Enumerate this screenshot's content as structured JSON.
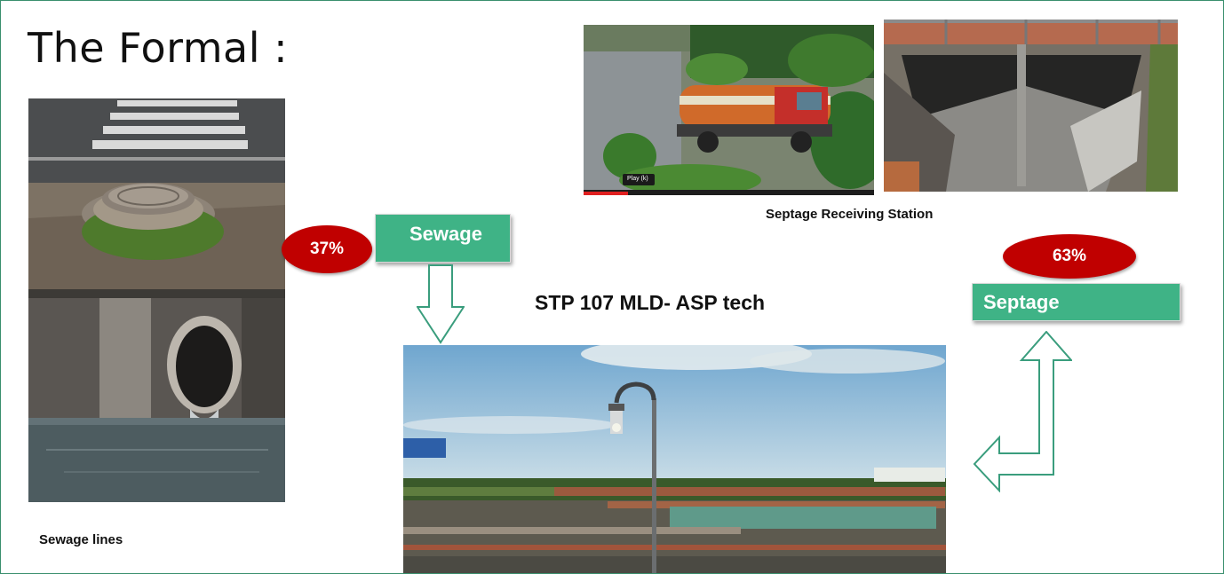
{
  "slide": {
    "title": "The Formal :",
    "sewage_caption": "Sewage lines",
    "septage_station_caption": "Septage Receiving Station",
    "stp_label": "STP 107 MLD- ASP tech",
    "sewage_box_label": "Sewage",
    "septage_box_label": "Septage",
    "sewage_percent": "37%",
    "septage_percent": "63%",
    "video_play_label": "Play (k)"
  },
  "colors": {
    "green_box": "#3fb386",
    "red_oval": "#c00000",
    "arrow_outline": "#3a9d7d"
  },
  "icons": {
    "down_arrow": "hollow-down-arrow",
    "bent_arrow": "hollow-double-bent-arrow"
  }
}
